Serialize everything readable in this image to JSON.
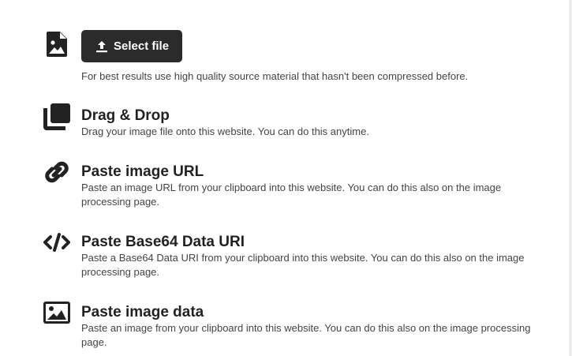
{
  "upload": {
    "icon": "image-file-icon",
    "button_icon": "upload-icon",
    "button_label": "Select file",
    "hint": "For best results use high quality source material that hasn't been compressed before."
  },
  "options": [
    {
      "icon": "drag-drop-icon",
      "title": "Drag & Drop",
      "desc": "Drag your image file onto this website. You can do this anytime."
    },
    {
      "icon": "link-icon",
      "title": "Paste image URL",
      "desc": "Paste an image URL from your clipboard into this website. You can do this also on the image processing page."
    },
    {
      "icon": "code-icon",
      "title": "Paste Base64 Data URI",
      "desc": "Paste a Base64 Data URI from your clipboard into this website. You can do this also on the image processing page."
    },
    {
      "icon": "image-icon",
      "title": "Paste image data",
      "desc": "Paste an image from your clipboard into this website. You can do this also on the image processing page."
    }
  ],
  "colors": {
    "button_bg": "#2b2b2b",
    "icon": "#222222",
    "text": "#444444"
  }
}
